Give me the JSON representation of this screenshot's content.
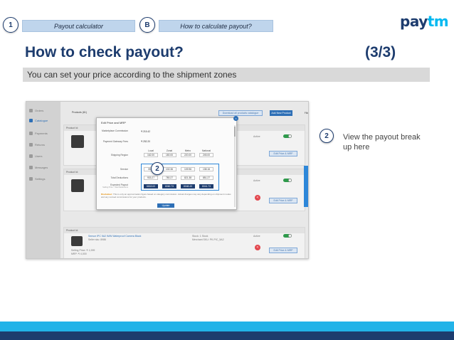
{
  "steps": [
    {
      "number": "1",
      "label": "Payout calculator"
    },
    {
      "number": "B",
      "label": "How to calculate payout?"
    }
  ],
  "logo": {
    "part1": "pay",
    "part2": "tm"
  },
  "title": "How to check payout?",
  "counter": "(3/3)",
  "subtitle": "You can set your price according to the shipment zones",
  "screenshot": {
    "sidebar": [
      "Orders",
      "Catalogue",
      "Payments",
      "Returns",
      "Users",
      "Messages",
      "Settings"
    ],
    "top_buttons": {
      "download": "Download all products catalogue",
      "add": "Add New Product",
      "filter": "Filter Products"
    },
    "products_label": "Products (61)",
    "product_header": "Product Id:",
    "active_label": "Active",
    "edit_price_label": "Edit Price & MRP",
    "product3_name": "Sensor IPC 5A2 IMW Waterproof Camera Black",
    "product3_sub": "Seller sku: 8986",
    "product3_stock": "Stock: 1 Stock",
    "product3_merchant": "Merchant SKU: PK-PIC_5A2",
    "product3_price": "Selling Price: ₹ 1,999",
    "product3_mrp": "MRP: ₹ 4,000",
    "modal": {
      "title": "Edit Price and MRP",
      "marketplace_label": "Marketplace Commission",
      "marketplace_value": "₹ 215.42",
      "payment_label": "Payment Gateway Fees",
      "payment_value": "₹ 252.20",
      "shipping_label": "Shipping Region",
      "zones": [
        "Local",
        "Zonal",
        "Metro",
        "National"
      ],
      "shipping_values": [
        "162.00",
        "180.00",
        "220.00",
        "245.00"
      ],
      "service_label": "Service",
      "service_values": [
        "39.80",
        "102.36",
        "109.96",
        "138.16"
      ],
      "total_label": "Total Deductions",
      "total_values": [
        "933.27",
        "780.27",
        "821.38",
        "851.27"
      ],
      "payout_label": "Expected Payout",
      "payout_sub": "Selling Price - Total Deductions",
      "payout_values": [
        "6618.63",
        "8060.73",
        "8048.43",
        "8041.73"
      ],
      "disclaimer_head": "Disclaimer:",
      "disclaimer": "This is only an approximation figure based on category commission. Actual charges may vary depending on shipment modes and any revised commissions for your products.",
      "update": "Update"
    }
  },
  "callouts": {
    "modal": "2",
    "side": "2"
  },
  "side_note": "View the payout break up here",
  "colors": {
    "navy": "#1d3c6e",
    "cyan": "#00b9f1",
    "accent_blue": "#2d87d9",
    "step_bar": "#bfd5ec"
  }
}
